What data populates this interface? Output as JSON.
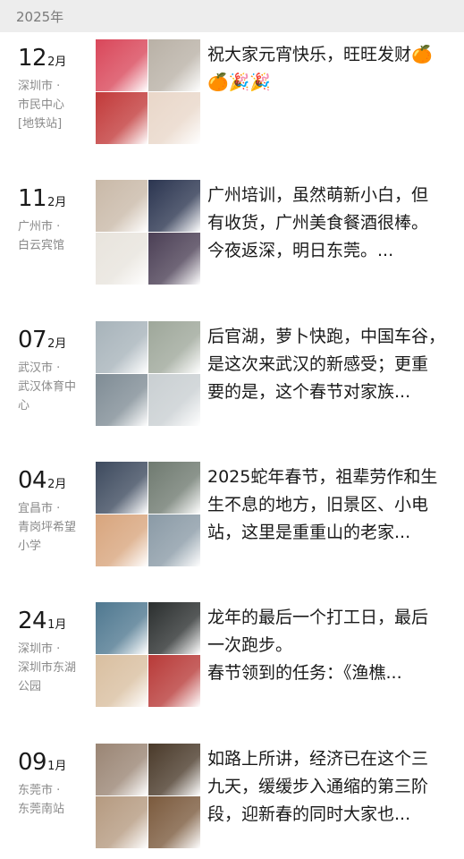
{
  "year": "2025年",
  "entries": [
    {
      "day": "12",
      "month": "2月",
      "location": [
        "深圳市 ·",
        "市民中心",
        "[地铁站]"
      ],
      "text": [
        "祝大家元宵快乐，旺旺发财🍊",
        "🍊🎉🎉"
      ],
      "photo_colors": [
        "#d9475a",
        "#b9b1a6",
        "#c23a3a",
        "#e9d7c9"
      ]
    },
    {
      "day": "11",
      "month": "2月",
      "location": [
        "广州市 ·",
        "白云宾馆"
      ],
      "text": [
        "广州培训，虽然萌新小白，但",
        "有收货，广州美食餐酒很棒。",
        "今夜返深，明日东莞。..."
      ],
      "photo_colors": [
        "#c9b9a8",
        "#2b3550",
        "#e8e4dd",
        "#4b3f55"
      ]
    },
    {
      "day": "07",
      "month": "2月",
      "location": [
        "武汉市 ·",
        "武汉体育中",
        "心"
      ],
      "text": [
        "后官湖，萝卜快跑，中国车谷，",
        "是这次来武汉的新感受；更重",
        "要的是，这个春节对家族..."
      ],
      "photo_colors": [
        "#a7b3ba",
        "#9ea79a",
        "#7f8c95",
        "#c9cfd2"
      ]
    },
    {
      "day": "04",
      "month": "2月",
      "location": [
        "宜昌市 ·",
        "青岗坪希望",
        "小学"
      ],
      "text": [
        "2025蛇年春节，祖辈劳作和生",
        "生不息的地方，旧景区、小电",
        "站，这里是重重山的老家..."
      ],
      "photo_colors": [
        "#3d4a5e",
        "#6f7a70",
        "#d8a57d",
        "#8a9aa6"
      ]
    },
    {
      "day": "24",
      "month": "1月",
      "location": [
        "深圳市 ·",
        "深圳市东湖",
        "公园"
      ],
      "text": [
        "龙年的最后一个打工日，最后",
        "一次跑步。",
        "春节领到的任务：《渔樵..."
      ],
      "photo_colors": [
        "#4f7890",
        "#2b2f2f",
        "#d9bfa0",
        "#b83a38"
      ]
    },
    {
      "day": "09",
      "month": "1月",
      "location": [
        "东莞市 ·",
        "东莞南站"
      ],
      "text": [
        "如路上所讲，经济已在这个三",
        "九天，缓缓步入通缩的第三阶",
        "段，迎新春的同时大家也..."
      ],
      "photo_colors": [
        "#9a8574",
        "#4a3a2a",
        "#b59a80",
        "#7b5a3d"
      ]
    }
  ]
}
